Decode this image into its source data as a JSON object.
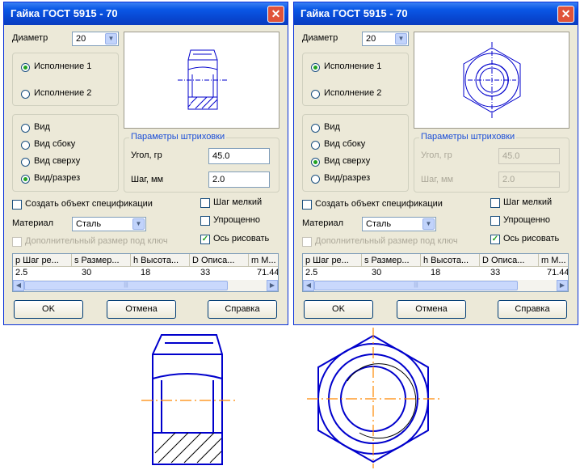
{
  "dialogs": [
    {
      "title": "Гайка ГОСТ 5915 - 70",
      "close_glyph": "✕",
      "diameter_label": "Диаметр",
      "diameter_value": "20",
      "execution": [
        "Исполнение 1",
        "Исполнение 2"
      ],
      "views": [
        "Вид",
        "Вид сбоку",
        "Вид сверху",
        "Вид/разрез"
      ],
      "hatch_group_title": "Параметры штриховки",
      "angle_label": "Угол, гр",
      "angle_value": "45.0",
      "step_label": "Шаг, мм",
      "step_value": "2.0",
      "create_spec_label": "Создать объект спецификации",
      "fine_step_label": "Шаг мелкий",
      "simplified_label": "Упрощенно",
      "material_label": "Материал",
      "material_value": "Сталь",
      "axis_label": "Ось рисовать",
      "extra_size_label": "Дополнительный размер под ключ",
      "table_headers": [
        "p Шаг ре...",
        "s Размер...",
        "h Высота...",
        "D Описа...",
        "m M..."
      ],
      "table_row": [
        "2.5",
        "30",
        "18",
        "33",
        "71.44"
      ],
      "ok_label": "OK",
      "cancel_label": "Отмена",
      "help_label": "Справка"
    },
    {
      "title": "Гайка ГОСТ 5915 - 70",
      "close_glyph": "✕",
      "diameter_label": "Диаметр",
      "diameter_value": "20",
      "execution": [
        "Исполнение 1",
        "Исполнение 2"
      ],
      "views": [
        "Вид",
        "Вид сбоку",
        "Вид сверху",
        "Вид/разрез"
      ],
      "hatch_group_title": "Параметры штриховки",
      "angle_label": "Угол, гр",
      "angle_value": "45.0",
      "step_label": "Шаг, мм",
      "step_value": "2.0",
      "create_spec_label": "Создать объект спецификации",
      "fine_step_label": "Шаг мелкий",
      "simplified_label": "Упрощенно",
      "material_label": "Материал",
      "material_value": "Сталь",
      "axis_label": "Ось рисовать",
      "extra_size_label": "Дополнительный размер под ключ",
      "table_headers": [
        "p Шаг ре...",
        "s Размер...",
        "h Высота...",
        "D Описа...",
        "m M..."
      ],
      "table_row": [
        "2.5",
        "30",
        "18",
        "33",
        "71.44"
      ],
      "ok_label": "OK",
      "cancel_label": "Отмена",
      "help_label": "Справка"
    }
  ],
  "colors": {
    "drawing_line": "#0000cc",
    "axis_line": "#ff8800",
    "title_bar": "#0a58e6"
  },
  "state": {
    "left": {
      "execution_selected": 1,
      "view_selected": "Вид/разрез",
      "axis_checked": true,
      "hatch_fields_enabled": true
    },
    "right": {
      "execution_selected": 1,
      "view_selected": "Вид сверху",
      "axis_checked": true,
      "hatch_fields_enabled": false
    }
  }
}
